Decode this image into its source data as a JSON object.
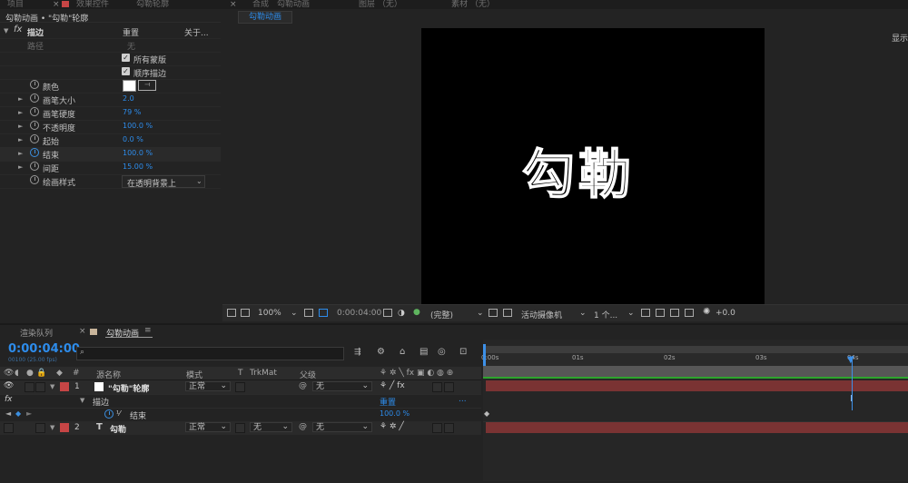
{
  "colors": {
    "accent": "#2d8ceb",
    "layer_bar": "#7a3333",
    "work_area": "#2ea52e",
    "label_red": "#c64545"
  },
  "top_tabs": [
    "项目",
    "效果控件",
    "勾勒轮廓",
    "合成",
    "勾勒动画",
    "图层 （无）",
    "素材 （无）"
  ],
  "effect_controls": {
    "breadcrumb": "勾勒动画 • \"勾勒\"轮廓",
    "effect_name": "描边",
    "reset_label": "重置",
    "about_label": "关于...",
    "path_label": "路径",
    "path_value": "无",
    "all_masks": "所有蒙版",
    "sequential": "顺序描边",
    "props": [
      {
        "name": "颜色",
        "value": ""
      },
      {
        "name": "画笔大小",
        "value": "2.0"
      },
      {
        "name": "画笔硬度",
        "value": "79 %"
      },
      {
        "name": "不透明度",
        "value": "100.0 %"
      },
      {
        "name": "起始",
        "value": "0.0 %"
      },
      {
        "name": "结束",
        "value": "100.0 %"
      },
      {
        "name": "间距",
        "value": "15.00 %"
      },
      {
        "name": "绘画样式",
        "value": "在透明背景上"
      }
    ]
  },
  "viewer": {
    "tab_label": "勾勒动画",
    "canvas_text": "勾勒",
    "side_label": "显示",
    "toolbar": {
      "zoom": "100%",
      "timecode": "0:00:04:00",
      "resolution": "(完整)",
      "camera": "活动摄像机",
      "views": "1 个...",
      "exposure": "+0.0"
    }
  },
  "timeline": {
    "tabs": [
      "渲染队列",
      "勾勒动画"
    ],
    "timecode": "0:00:04:00",
    "fps": "00100 (25.00 fps)",
    "search_placeholder": "",
    "columns": {
      "num": "#",
      "source": "源名称",
      "mode": "模式",
      "t": "T",
      "trkmat": "TrkMat",
      "parent": "父级"
    },
    "layers": [
      {
        "num": "1",
        "name": "\"勾勒\"轮廓",
        "mode": "正常",
        "trkmat": "",
        "parent": "无"
      },
      {
        "num": "2",
        "name": "勾勒",
        "mode": "正常",
        "trkmat": "无",
        "parent": "无"
      }
    ],
    "effect_row": {
      "name": "描边",
      "reset": "重置",
      "more": "..."
    },
    "property_row": {
      "name": "结束",
      "value": "100.0 %"
    },
    "ruler_ticks": [
      "0:00s",
      "01s",
      "02s",
      "03s",
      "04s"
    ],
    "current_time_seconds": 4
  }
}
